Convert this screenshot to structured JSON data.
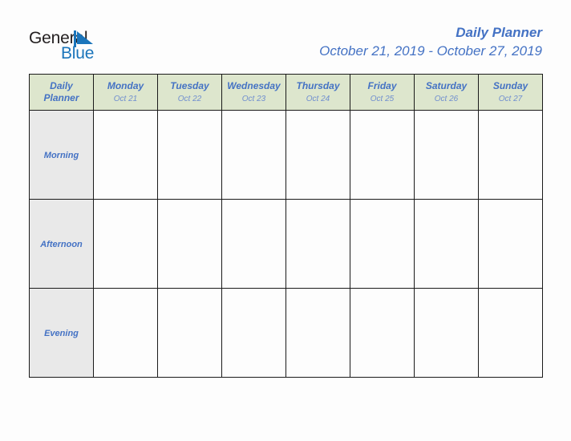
{
  "brand": {
    "name_dark": "General",
    "name_blue": "Blue",
    "mark_icon": "triangle-flag-icon"
  },
  "header": {
    "title": "Daily Planner",
    "date_range": "October 21, 2019 - October 27, 2019"
  },
  "colors": {
    "title_blue": "#4472c4",
    "header_green": "#dde6cd",
    "label_gray": "#e9e9e9",
    "brand_blue": "#1b75bb",
    "border": "#1a1a1a",
    "page_background": "#fdfdfd"
  },
  "table": {
    "corner": {
      "line1": "Daily",
      "line2": "Planner"
    },
    "columns": [
      {
        "day": "Monday",
        "date": "Oct 21"
      },
      {
        "day": "Tuesday",
        "date": "Oct 22"
      },
      {
        "day": "Wednesday",
        "date": "Oct 23"
      },
      {
        "day": "Thursday",
        "date": "Oct 24"
      },
      {
        "day": "Friday",
        "date": "Oct 25"
      },
      {
        "day": "Saturday",
        "date": "Oct 26"
      },
      {
        "day": "Sunday",
        "date": "Oct 27"
      }
    ],
    "rows": [
      {
        "label": "Morning",
        "cells": [
          "",
          "",
          "",
          "",
          "",
          "",
          ""
        ]
      },
      {
        "label": "Afternoon",
        "cells": [
          "",
          "",
          "",
          "",
          "",
          "",
          ""
        ]
      },
      {
        "label": "Evening",
        "cells": [
          "",
          "",
          "",
          "",
          "",
          "",
          ""
        ]
      }
    ]
  }
}
